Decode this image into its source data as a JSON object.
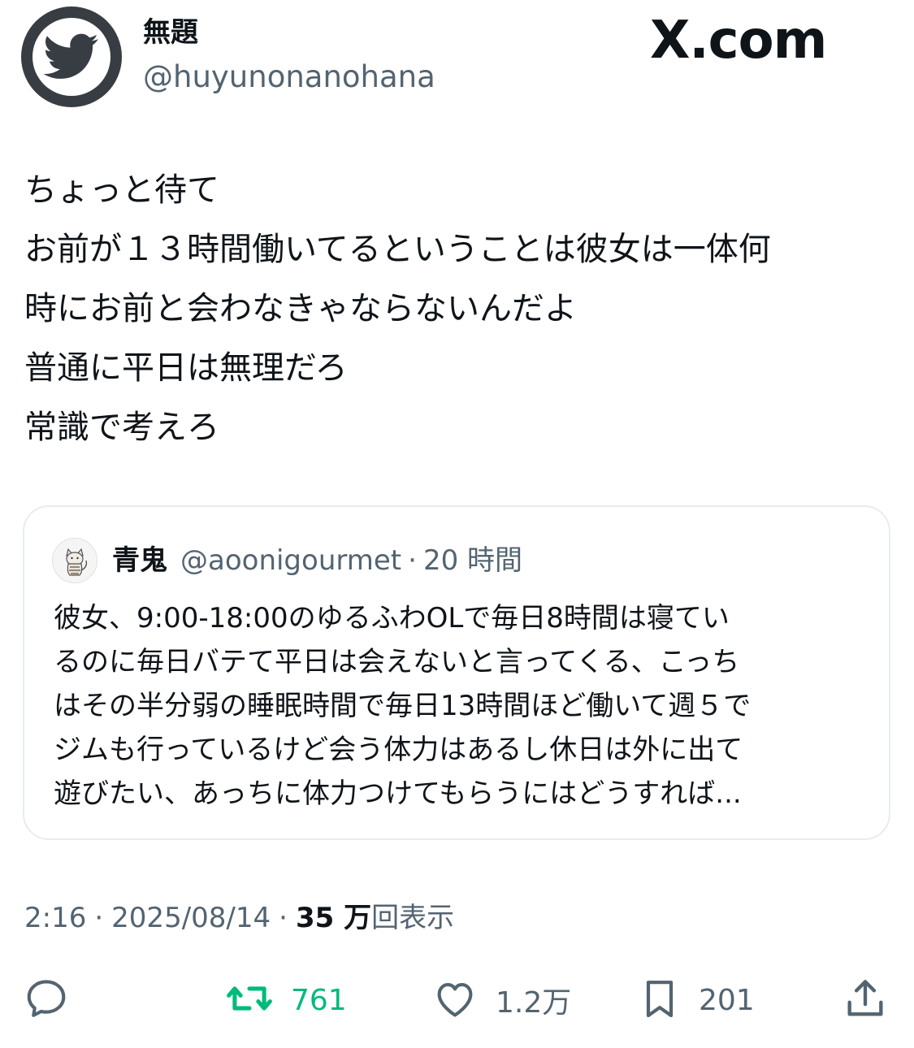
{
  "author": {
    "display_name": "無題",
    "handle": "@huyunonanohana",
    "avatar_icon": "twitter-bird-icon"
  },
  "brand": {
    "text": "X.com"
  },
  "tweet": {
    "lines": [
      "ちょっと待て",
      "お前が１３時間働いてるということは彼女は一体何",
      "時にお前と会わなきゃならないんだよ",
      "普通に平日は無理だろ",
      "常識で考えろ"
    ]
  },
  "quote": {
    "name": "青鬼",
    "handle": "@aoonigourmet",
    "separator": "·",
    "time": "20 時間",
    "avatar_icon": "cat-illustration-icon",
    "lines": [
      "彼女、9:00-18:00のゆるふわOLで毎日8時間は寝てい",
      "るのに毎日バテて平日は会えないと言ってくる、こっち",
      "はその半分弱の睡眠時間で毎日13時間ほど働いて週５で",
      "ジムも行っているけど会う体力はあるし休日は外に出て",
      "遊びたい、あっちに体力つけてもらうにはどうすれば..."
    ]
  },
  "meta": {
    "time": "2:16",
    "separator": "·",
    "date": "2025/08/14",
    "views_count": "35 万",
    "views_label": "回表示"
  },
  "actions": {
    "reply": {
      "icon": "reply-icon"
    },
    "retweet": {
      "icon": "retweet-icon",
      "count": "761",
      "color": "#00ba7c"
    },
    "like": {
      "icon": "heart-icon",
      "count": "1.2万"
    },
    "bookmark": {
      "icon": "bookmark-icon",
      "count": "201"
    },
    "share": {
      "icon": "share-icon"
    }
  }
}
